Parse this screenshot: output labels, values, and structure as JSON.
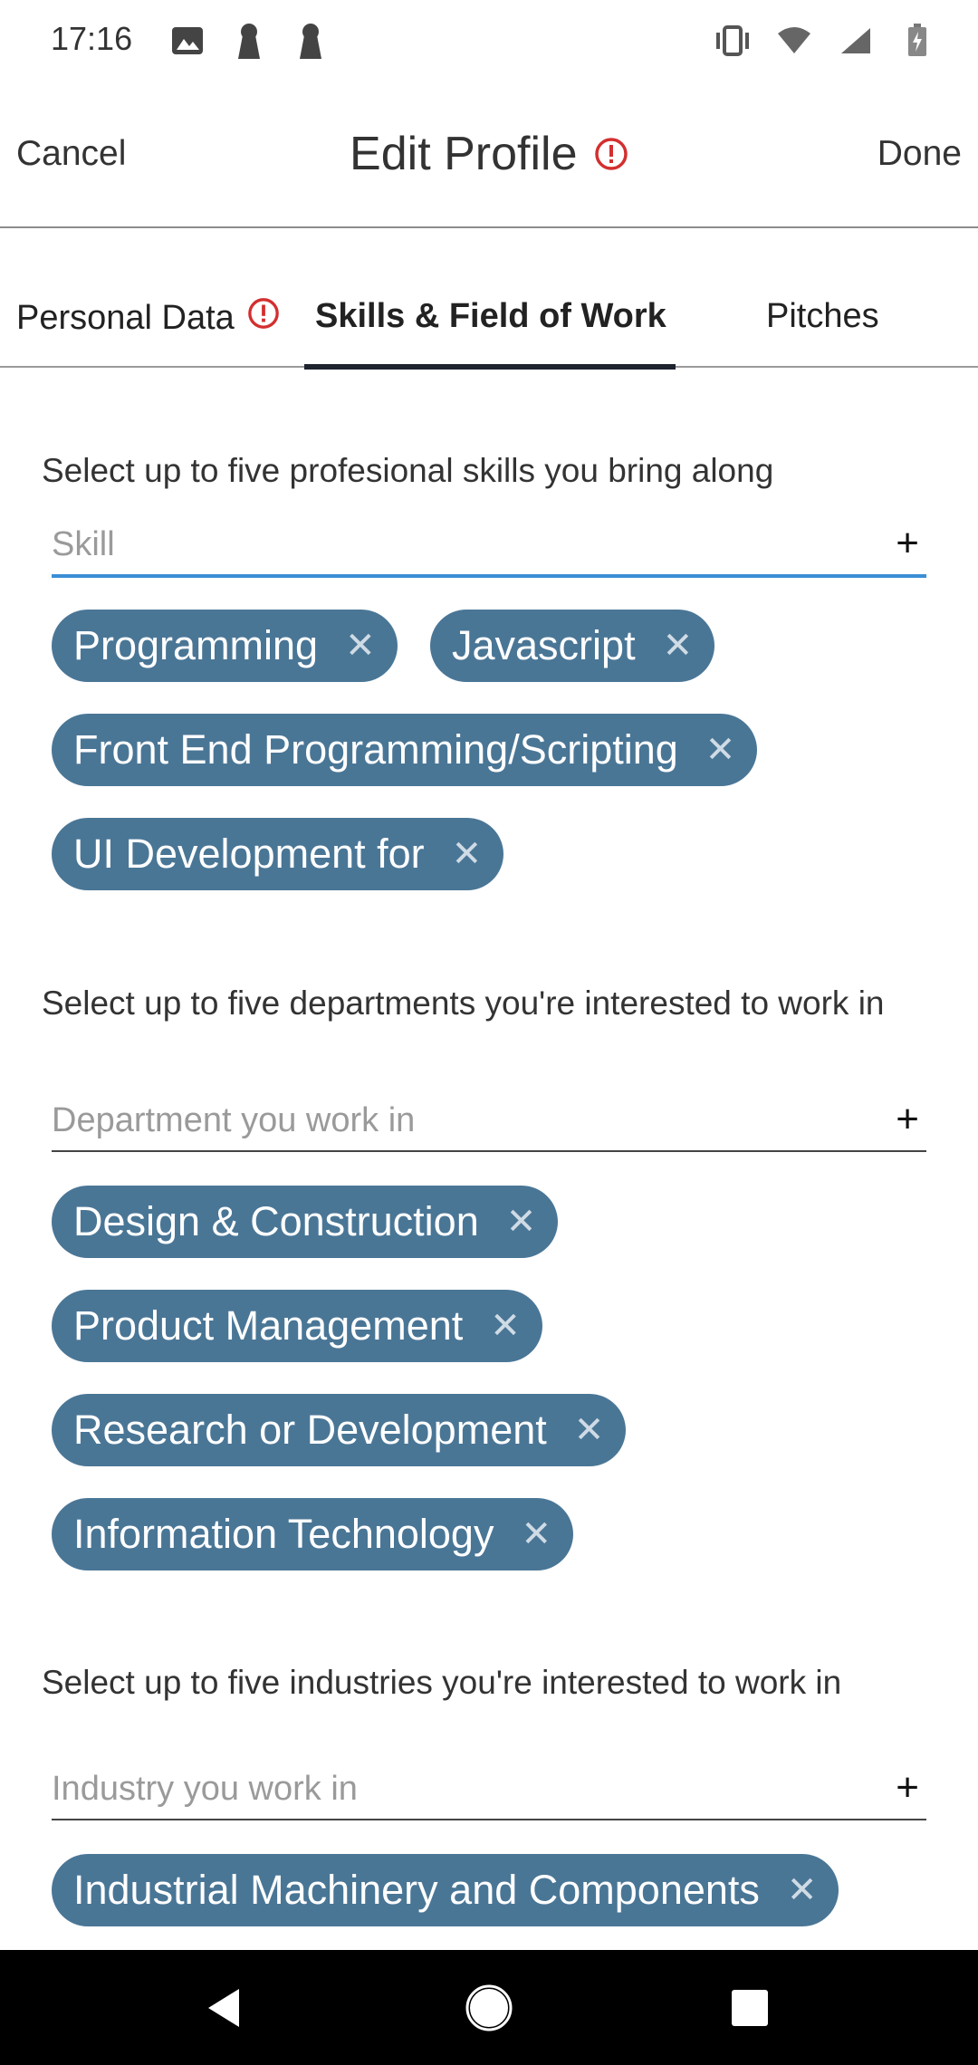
{
  "status_bar": {
    "time": "17:16",
    "left_icons": [
      "image-icon",
      "keyhole-icon",
      "keyhole-icon"
    ],
    "right_icons": [
      "vibrate-icon",
      "wifi-icon",
      "signal-icon",
      "battery-icon"
    ]
  },
  "header": {
    "cancel_label": "Cancel",
    "title": "Edit Profile",
    "done_label": "Done",
    "alert_color": "#d32f2f"
  },
  "tabs": [
    {
      "label": "Personal Data",
      "has_alert": true
    },
    {
      "label": "Skills & Field of Work",
      "selected": true
    },
    {
      "label": "Pitches"
    }
  ],
  "skills": {
    "label": "Select up to five profesional skills you bring along",
    "placeholder": "Skill",
    "chips": [
      "Programming",
      "Javascript",
      "Front End Programming/Scripting",
      "UI Development for"
    ]
  },
  "departments": {
    "label": "Select up to five departments you're interested to work in",
    "placeholder": "Department you work in",
    "chips": [
      "Design & Construction",
      "Product Management",
      "Research or Development",
      "Information Technology"
    ]
  },
  "industries": {
    "label": "Select up to five industries you're interested to work in",
    "placeholder": "Industry you work in",
    "chips": [
      "Industrial Machinery and Components"
    ]
  },
  "add_symbol": "+",
  "chip_close_symbol": "✕",
  "colors": {
    "chip_bg": "#4a7696",
    "active_underline": "#3a8fd6",
    "tab_indicator": "#1f2330"
  }
}
